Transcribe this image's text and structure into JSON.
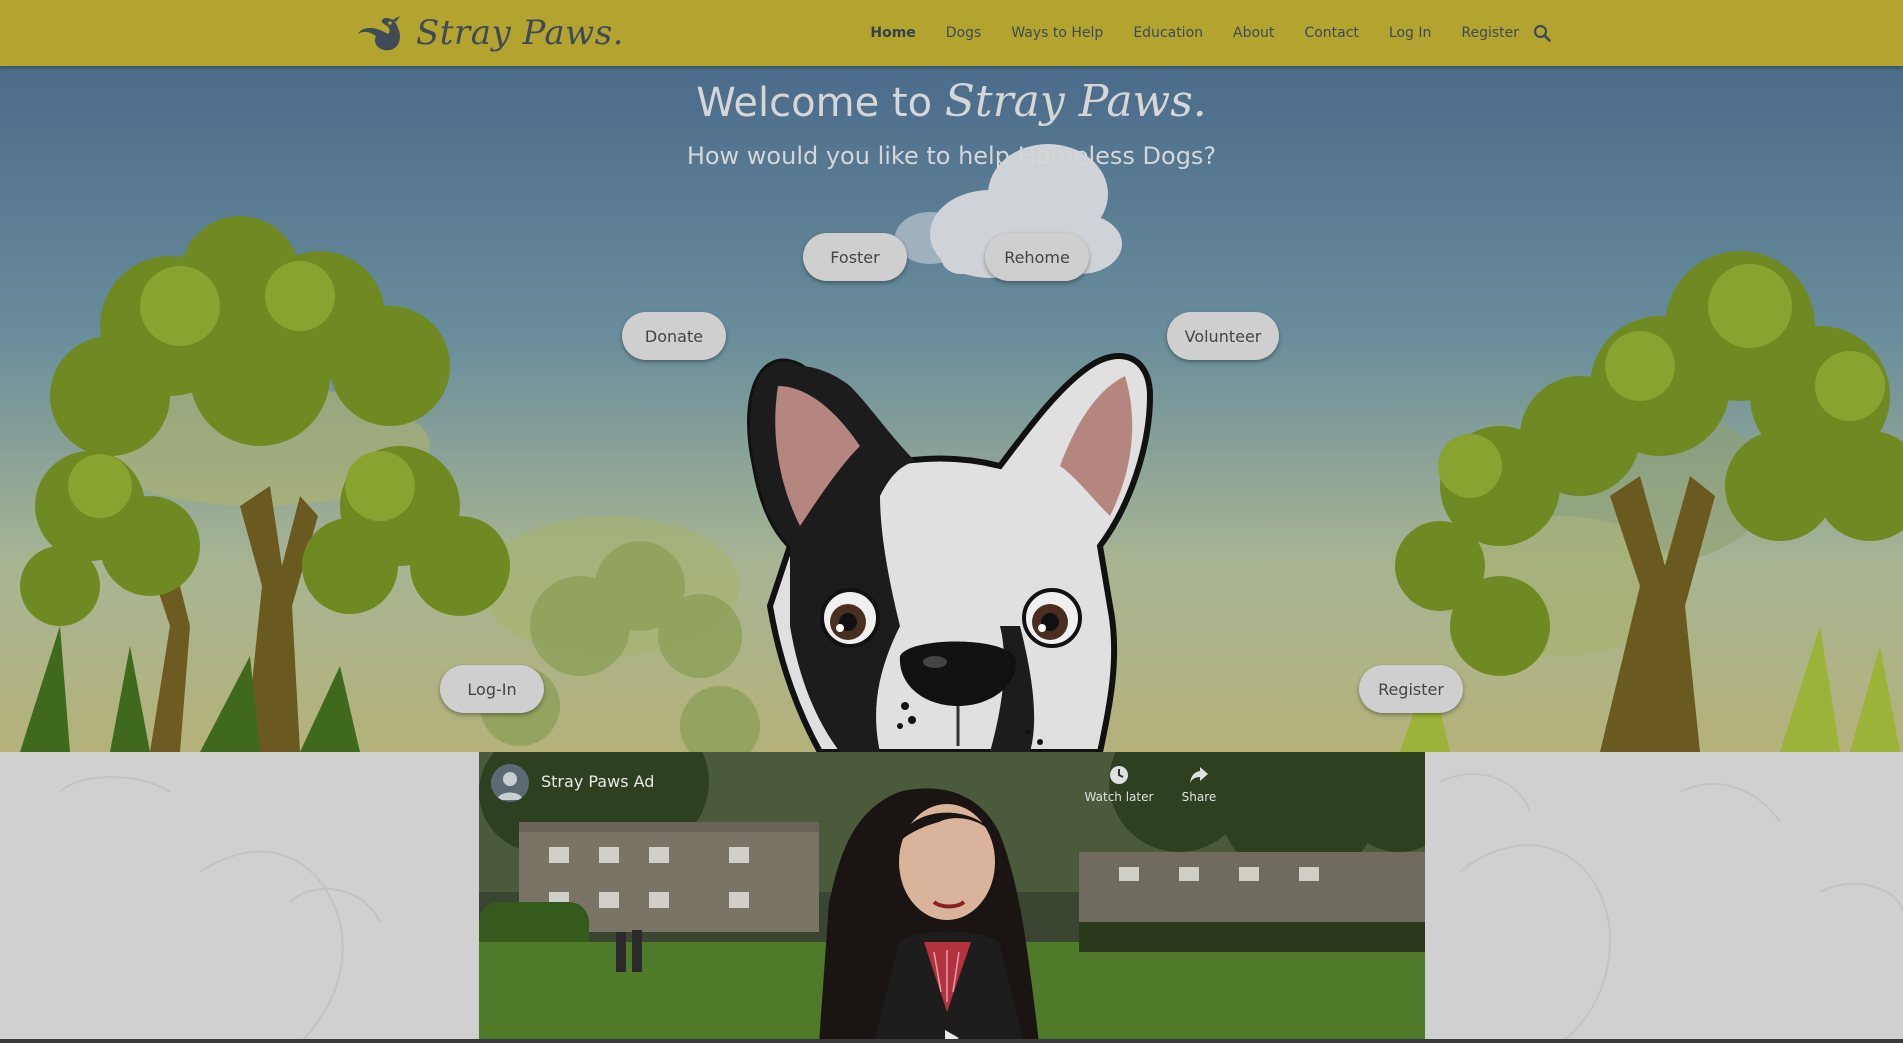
{
  "header": {
    "brand": "Stray Paws.",
    "nav": [
      "Home",
      "Dogs",
      "Ways to Help",
      "Education",
      "About",
      "Contact",
      "Log In",
      "Register"
    ],
    "active": "Home",
    "search_icon": "search-icon"
  },
  "hero": {
    "title_prefix": "Welcome to",
    "title_brand": "Stray Paws.",
    "subtitle": "How would you like to help Homeless Dogs?",
    "buttons": {
      "foster": "Foster",
      "rehome": "Rehome",
      "donate": "Donate",
      "volunteer": "Volunteer",
      "login": "Log-In",
      "register": "Register"
    }
  },
  "video": {
    "title": "Stray Paws Ad",
    "watch_later": "Watch later",
    "share": "Share",
    "icons": [
      "avatar-icon",
      "clock-icon",
      "share-icon",
      "play-icon"
    ]
  },
  "colors": {
    "header": "#b3a32f",
    "button": "#cfcfcf",
    "lower": "#d0d0d0"
  }
}
